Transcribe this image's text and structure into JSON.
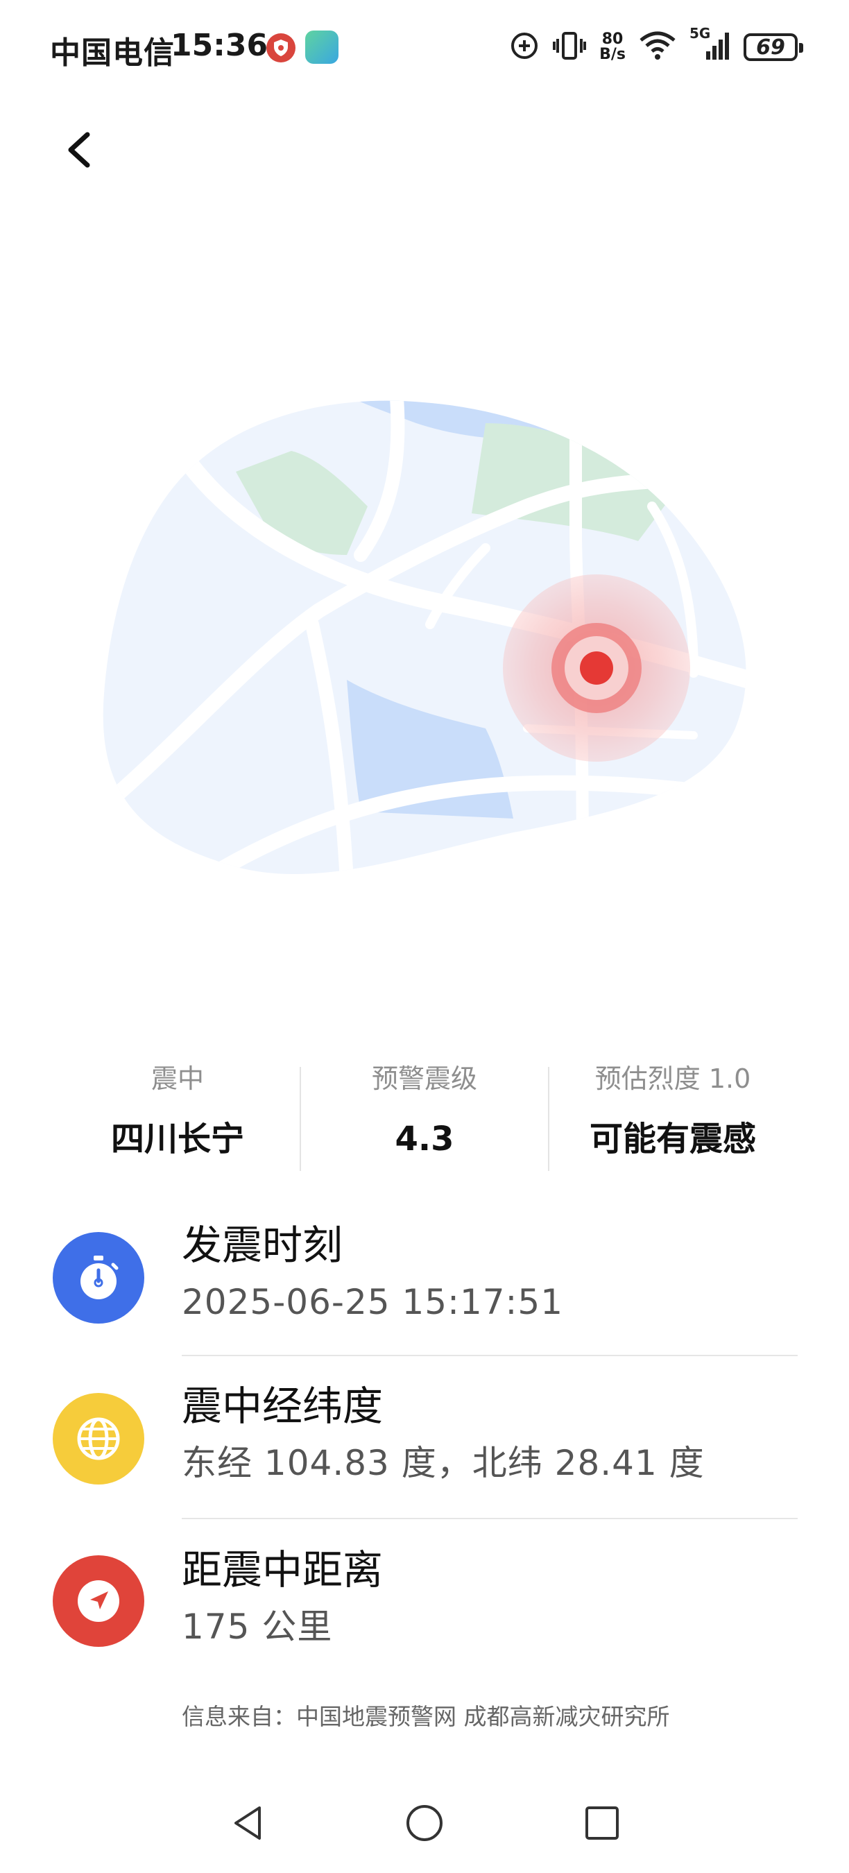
{
  "status_bar": {
    "carrier": "中国电信",
    "time": "15:36",
    "speed_value": "80",
    "speed_unit": "B/s",
    "network": "5G",
    "battery": "69"
  },
  "stats": [
    {
      "label": "震中",
      "value": "四川长宁"
    },
    {
      "label": "预警震级",
      "value": "4.3"
    },
    {
      "label": "预估烈度 1.0",
      "value": "可能有震感"
    }
  ],
  "info": {
    "time": {
      "title": "发震时刻",
      "value": "2025-06-25 15:17:51",
      "icon": "stopwatch-icon",
      "color": "#3f6fe8"
    },
    "coords": {
      "title": "震中经纬度",
      "value": "东经 104.83 度，北纬 28.41 度",
      "icon": "globe-icon",
      "color": "#f6cc3b"
    },
    "distance": {
      "title": "距震中距离",
      "value": "175 公里",
      "icon": "navigation-arrow-icon",
      "color": "#e0443a"
    }
  },
  "source": "信息来自：中国地震预警网 成都高新减灾研究所",
  "colors": {
    "epicenter": "#e53935",
    "map_land": "#eef4fd",
    "map_water": "#c9ddfa",
    "map_green": "#d4ebdc"
  }
}
